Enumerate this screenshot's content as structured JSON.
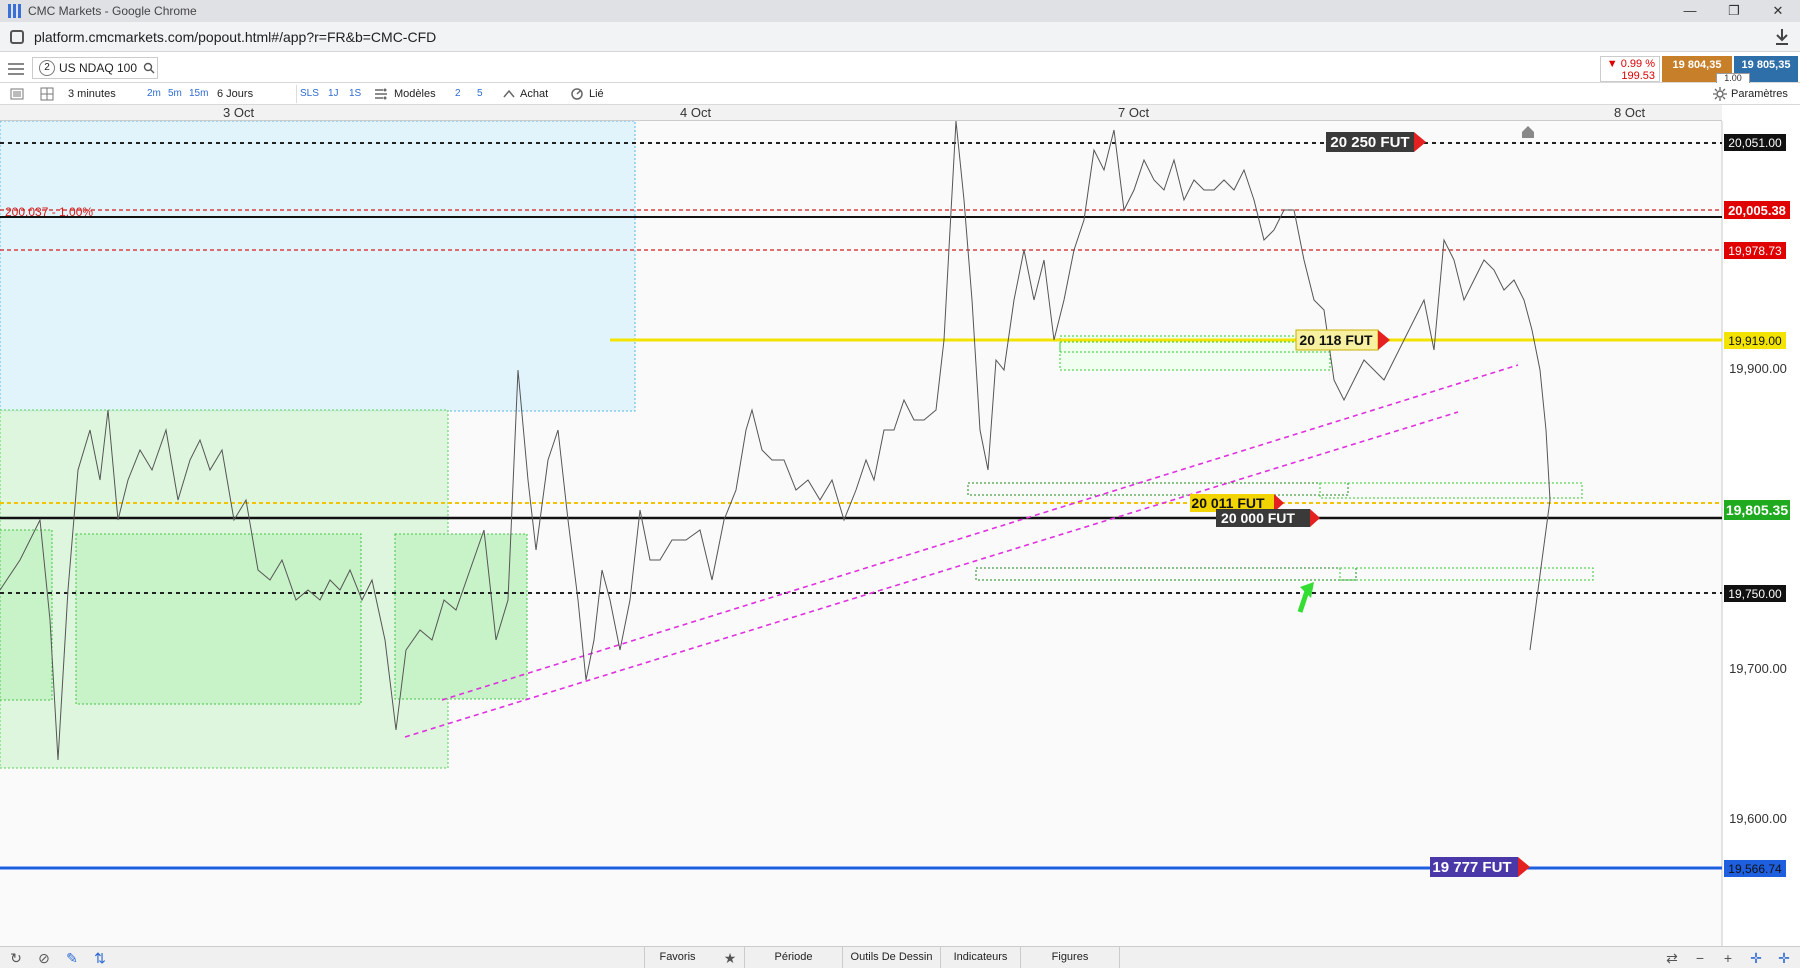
{
  "browser": {
    "window_title": "CMC Markets - Google Chrome",
    "url": "platform.cmcmarkets.com/popout.html#/app?r=FR&b=CMC-CFD"
  },
  "instrument": {
    "number": "2",
    "name": "US NDAQ 100",
    "change_pct": "▼ 0.99 %",
    "change_pts": "199.53",
    "sell": "19 804,35",
    "buy": "19 805,35",
    "spread": "1.00"
  },
  "toolbar": {
    "timeframe": "3 minutes",
    "tf_2m": "2m",
    "tf_5m": "5m",
    "tf_15m": "15m",
    "range": "6 Jours",
    "sls": "SLS",
    "one_j": "1J",
    "one_s": "1S",
    "models": "Modèles",
    "n2": "2",
    "n5": "5",
    "buy_label": "Achat",
    "link_label": "Lié",
    "settings": "Paramètres"
  },
  "dates": [
    "3 Oct",
    "4 Oct",
    "7 Oct",
    "8 Oct"
  ],
  "axis_ticks": [
    "19,900.00",
    "19,700.00",
    "19,600.00"
  ],
  "price_tags": {
    "p20051": "20,051.00",
    "p20005": "20,005.38",
    "p19978": "19,978.73",
    "p19919": "19,919.00",
    "p19805": "19,805.35",
    "p19750": "19,750.00",
    "p19566": "19,566.74"
  },
  "level_labels": {
    "fut20250": "20 250 FUT",
    "fut20118": "20 118 FUT",
    "fut20011": "20 011 FUT",
    "fut20000": "20 000 FUT",
    "fut19777": "19 777 FUT",
    "pct_line": "200.037 - 1.00%"
  },
  "colors": {
    "up": "#2a7fd6",
    "down": "#cc2222",
    "yellow": "#f2e400",
    "magenta": "#e030e0",
    "red_dashed": "#d41c1c",
    "blue_line": "#1e5fe0",
    "green_zone": "#c8f2c8"
  },
  "bottom": {
    "favoris": "Favoris",
    "periode": "Période",
    "outils": "Outils De Dessin",
    "indicateurs": "Indicateurs",
    "figures": "Figures"
  }
}
